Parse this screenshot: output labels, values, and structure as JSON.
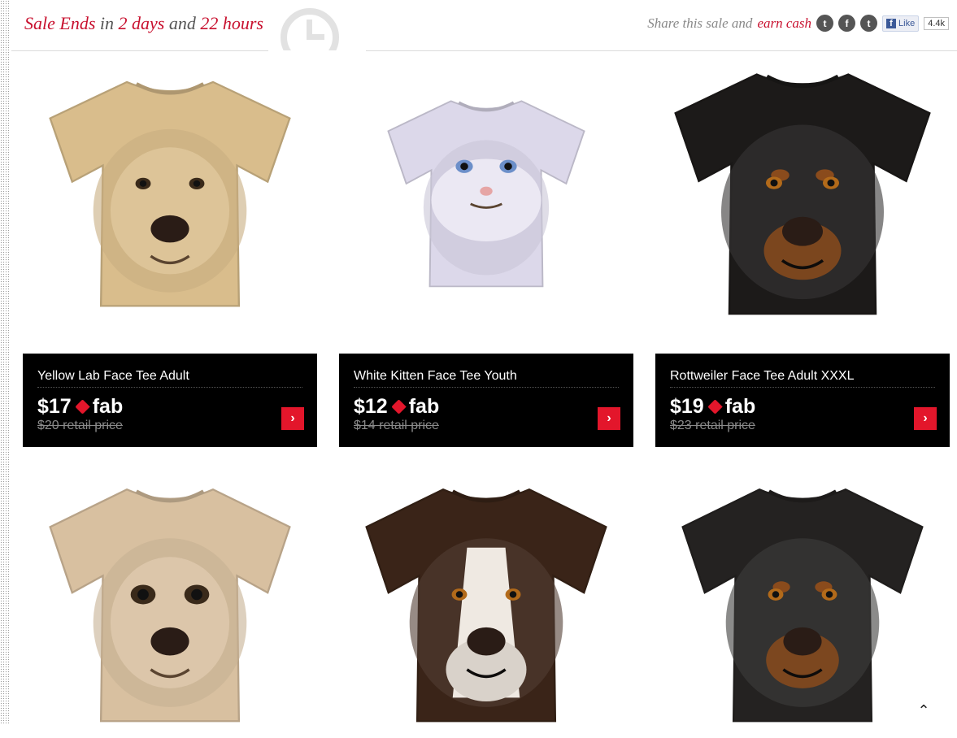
{
  "header": {
    "sale_prefix": "Sale Ends",
    "sale_in": "in",
    "sale_days": "2 days",
    "sale_and": "and",
    "sale_hours": "22 hours",
    "share_text": "Share this sale and",
    "earn_cash": "earn cash",
    "social_icons": [
      "twitter-icon",
      "facebook-icon",
      "tumblr-icon"
    ],
    "like_label": "Like",
    "like_count": "4.4k"
  },
  "products": [
    {
      "name": "Yellow Lab Face Tee Adult",
      "price": "$17",
      "brand": "fab",
      "retail": "$20 retail price",
      "shirt_color": "#d9bd8c",
      "face": "yellow-lab"
    },
    {
      "name": "White Kitten Face Tee Youth",
      "price": "$12",
      "brand": "fab",
      "retail": "$14 retail price",
      "shirt_color": "#dcd8ea",
      "face": "white-kitten"
    },
    {
      "name": "Rottweiler Face Tee Adult XXXL",
      "price": "$19",
      "brand": "fab",
      "retail": "$23 retail price",
      "shirt_color": "#1c1a19",
      "face": "rottweiler"
    },
    {
      "face": "chihuahua",
      "shirt_color": "#d8c0a0"
    },
    {
      "face": "saint-bernard",
      "shirt_color": "#3a2418"
    },
    {
      "face": "dachshund",
      "shirt_color": "#242221"
    }
  ],
  "colors": {
    "accent": "#e3162b",
    "sale_red": "#c8102e",
    "panel": "#000000"
  }
}
